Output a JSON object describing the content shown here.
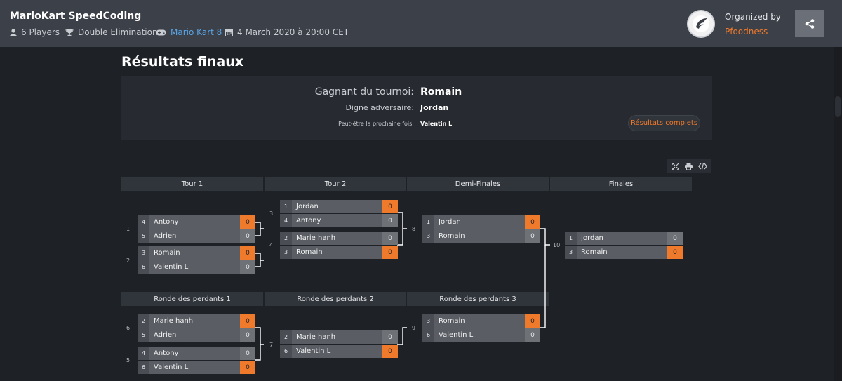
{
  "header": {
    "title": "MarioKart SpeedCoding",
    "players": "6 Players",
    "format": "Double Elimination",
    "game": "Mario Kart 8",
    "date": "4 March 2020 à 20:00 CET",
    "organized_by_label": "Organized by",
    "organizer": "Pfoodness"
  },
  "results": {
    "title": "Résultats finaux",
    "winner_label": "Gagnant du tournoi:",
    "winner": "Romain",
    "runner_up_label": "Digne adversaire:",
    "runner_up": "Jordan",
    "third_label": "Peut-être la prochaine fois:",
    "third": "Valentin L",
    "full_results_button": "Résultats complets"
  },
  "rounds": {
    "winners": [
      "Tour 1",
      "Tour 2",
      "Demi-Finales",
      "Finales"
    ],
    "losers": [
      "Ronde des perdants 1",
      "Ronde des perdants 2",
      "Ronde des perdants 3"
    ]
  },
  "matches": {
    "m1": {
      "number": "1",
      "p1": {
        "seed": "4",
        "name": "Antony",
        "score": "0"
      },
      "p2": {
        "seed": "5",
        "name": "Adrien",
        "score": "0"
      }
    },
    "m2": {
      "number": "2",
      "p1": {
        "seed": "3",
        "name": "Romain",
        "score": "0"
      },
      "p2": {
        "seed": "6",
        "name": "Valentin L",
        "score": "0"
      }
    },
    "m3": {
      "number": "3",
      "p1": {
        "seed": "1",
        "name": "Jordan",
        "score": "0"
      },
      "p2": {
        "seed": "4",
        "name": "Antony",
        "score": "0"
      }
    },
    "m4": {
      "number": "4",
      "p1": {
        "seed": "2",
        "name": "Marie hanh",
        "score": "0"
      },
      "p2": {
        "seed": "3",
        "name": "Romain",
        "score": "0"
      }
    },
    "m8": {
      "number": "8",
      "p1": {
        "seed": "1",
        "name": "Jordan",
        "score": "0"
      },
      "p2": {
        "seed": "3",
        "name": "Romain",
        "score": "0"
      }
    },
    "m10": {
      "number": "10",
      "p1": {
        "seed": "1",
        "name": "Jordan",
        "score": "0"
      },
      "p2": {
        "seed": "3",
        "name": "Romain",
        "score": "0"
      }
    },
    "m6": {
      "number": "6",
      "p1": {
        "seed": "2",
        "name": "Marie hanh",
        "score": "0"
      },
      "p2": {
        "seed": "5",
        "name": "Adrien",
        "score": "0"
      }
    },
    "m5": {
      "number": "5",
      "p1": {
        "seed": "4",
        "name": "Antony",
        "score": "0"
      },
      "p2": {
        "seed": "6",
        "name": "Valentin L",
        "score": "0"
      }
    },
    "m7": {
      "number": "7",
      "p1": {
        "seed": "2",
        "name": "Marie hanh",
        "score": "0"
      },
      "p2": {
        "seed": "6",
        "name": "Valentin L",
        "score": "0"
      }
    },
    "m9": {
      "number": "9",
      "p1": {
        "seed": "3",
        "name": "Romain",
        "score": "0"
      },
      "p2": {
        "seed": "6",
        "name": "Valentin L",
        "score": "0"
      }
    }
  },
  "colors": {
    "accent": "#f07a2b",
    "link": "#5aa5e6",
    "background": "#1e2126",
    "header": "#3c4049"
  },
  "icons": [
    "user-icon",
    "trophy-icon",
    "gamepad-icon",
    "calendar-icon",
    "share-icon",
    "fullscreen-icon",
    "print-icon",
    "embed-code-icon"
  ]
}
